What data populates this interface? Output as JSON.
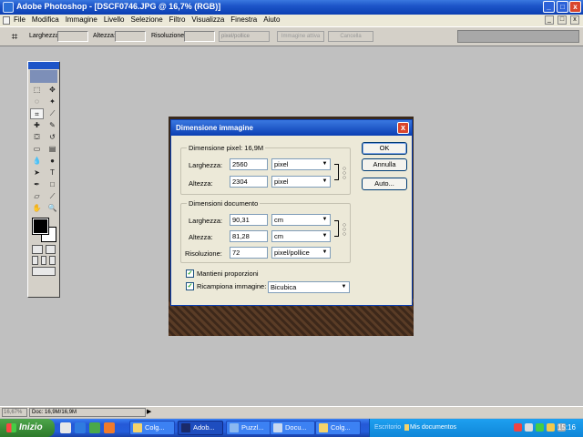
{
  "window": {
    "title": "Adobe Photoshop - [DSCF0746.JPG @ 16,7% (RGB)]",
    "controls": [
      "_",
      "□",
      "x"
    ]
  },
  "menu": [
    "File",
    "Modifica",
    "Immagine",
    "Livello",
    "Selezione",
    "Filtro",
    "Visualizza",
    "Finestra",
    "Aiuto"
  ],
  "options": {
    "width_label": "Larghezza:",
    "height_label": "Altezza:",
    "resolution_label": "Risoluzione:",
    "resolution_unit": "pixel/pollice",
    "front_image_button": "Immagine attiva",
    "clear_button": "Cancella"
  },
  "dialog": {
    "title": "Dimensione immagine",
    "pixel_section": {
      "legend": "Dimensione pixel: 16,9M",
      "width_label": "Larghezza:",
      "width_value": "2560",
      "width_unit": "pixel",
      "height_label": "Altezza:",
      "height_value": "2304",
      "height_unit": "pixel"
    },
    "document_section": {
      "legend": "Dimensioni documento",
      "width_label": "Larghezza:",
      "width_value": "90,31",
      "width_unit": "cm",
      "height_label": "Altezza:",
      "height_value": "81,28",
      "height_unit": "cm",
      "resolution_label": "Risoluzione:",
      "resolution_value": "72",
      "resolution_unit": "pixel/pollice"
    },
    "constrain_label": "Mantieni proporzioni",
    "constrain_checked": true,
    "resample_label": "Ricampiona immagine:",
    "resample_checked": true,
    "resample_method": "Bicubica",
    "buttons": {
      "ok": "OK",
      "cancel": "Annulla",
      "auto": "Auto..."
    }
  },
  "status": {
    "zoom": "16,67%",
    "doc_info": "Doc: 16,9M/16,9M"
  },
  "taskbar": {
    "start": "Inizio",
    "tasks": [
      "Colg...",
      "Adob...",
      "Puzzl...",
      "Docu...",
      "Colg..."
    ],
    "active_task_index": 1,
    "desktop_label": "Escritorio",
    "my_docs": "Mis documentos",
    "clock": "15:16"
  },
  "colors": {
    "xp_blue": "#0b3fb3",
    "dialog_bg": "#ece9d8",
    "app_bg": "#c0c0c0",
    "start_green": "#3c8f39"
  }
}
